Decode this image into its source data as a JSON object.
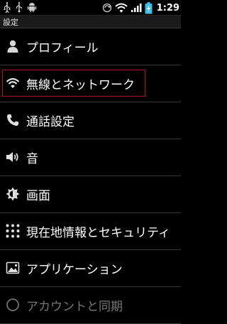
{
  "status_bar": {
    "left_icons": [
      "usb-icon",
      "usb-debug-icon",
      "android-icon"
    ],
    "right_icons": [
      "sync-icon",
      "wifi-icon",
      "signal-icon",
      "battery-charging-icon"
    ],
    "time": "1:29"
  },
  "header": {
    "title": "設定"
  },
  "menu": {
    "items": [
      {
        "label": "プロフィール",
        "icon": "person-icon"
      },
      {
        "label": "無線とネットワーク",
        "icon": "wifi-icon"
      },
      {
        "label": "通話設定",
        "icon": "phone-icon"
      },
      {
        "label": "音",
        "icon": "speaker-icon"
      },
      {
        "label": "画面",
        "icon": "brightness-icon"
      },
      {
        "label": "現在地情報とセキュリティ",
        "icon": "location-grid-icon"
      },
      {
        "label": "アプリケーション",
        "icon": "applications-icon"
      },
      {
        "label": "アカウントと同期",
        "icon": "sync-icon"
      }
    ]
  },
  "colors": {
    "highlight_border": "#b3122d",
    "battery": "#3fbfe8"
  }
}
